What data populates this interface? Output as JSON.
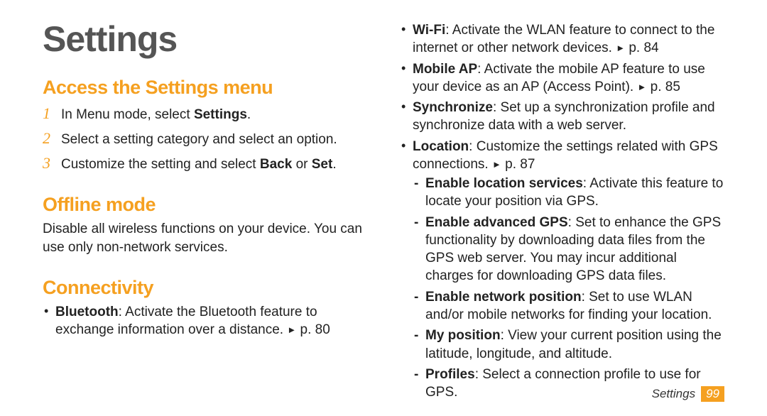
{
  "title": "Settings",
  "sections": {
    "access": {
      "heading": "Access the Settings menu",
      "steps": [
        {
          "num": "1",
          "pre": "In Menu mode, select ",
          "bold": "Settings",
          "post": "."
        },
        {
          "num": "2",
          "pre": "Select a setting category and select an option.",
          "bold": "",
          "post": ""
        },
        {
          "num": "3",
          "pre": "Customize the setting and select ",
          "bold": "Back",
          "mid": " or ",
          "bold2": "Set",
          "post": "."
        }
      ]
    },
    "offline": {
      "heading": "Offline mode",
      "body": "Disable all wireless functions on your device. You can use only non-network services."
    },
    "connectivity": {
      "heading": "Connectivity",
      "bluetooth": {
        "label": "Bluetooth",
        "text": ": Activate the Bluetooth feature to exchange information over a distance. ",
        "ref": "p. 80"
      },
      "wifi": {
        "label": "Wi-Fi",
        "text": ": Activate the WLAN feature to connect to the internet or other network devices. ",
        "ref": "p. 84"
      },
      "mobile_ap": {
        "label": "Mobile AP",
        "text": ": Activate the mobile AP feature to use your device as an AP (Access Point). ",
        "ref": "p. 85"
      },
      "synchronize": {
        "label": "Synchronize",
        "text": ": Set up a synchronization profile and synchronize data with a web server."
      },
      "location": {
        "label": "Location",
        "text": ": Customize the settings related with GPS connections. ",
        "ref": "p. 87",
        "subs": {
          "services": {
            "label": "Enable location services",
            "text": ": Activate this feature to locate your position via GPS."
          },
          "advanced": {
            "label": "Enable advanced GPS",
            "text": ": Set to enhance the GPS functionality by downloading data files from the GPS web server. You may incur additional charges for downloading GPS data files."
          },
          "network": {
            "label": "Enable network position",
            "text": ": Set to use WLAN and/or mobile networks for finding your location."
          },
          "myposition": {
            "label": "My position",
            "text": ": View your current position using the latitude, longitude, and altitude."
          },
          "profiles": {
            "label": "Profiles",
            "text": ": Select a connection profile to use for GPS."
          }
        }
      }
    }
  },
  "footer": {
    "section": "Settings",
    "page": "99"
  },
  "glyphs": {
    "arrow": "►"
  }
}
